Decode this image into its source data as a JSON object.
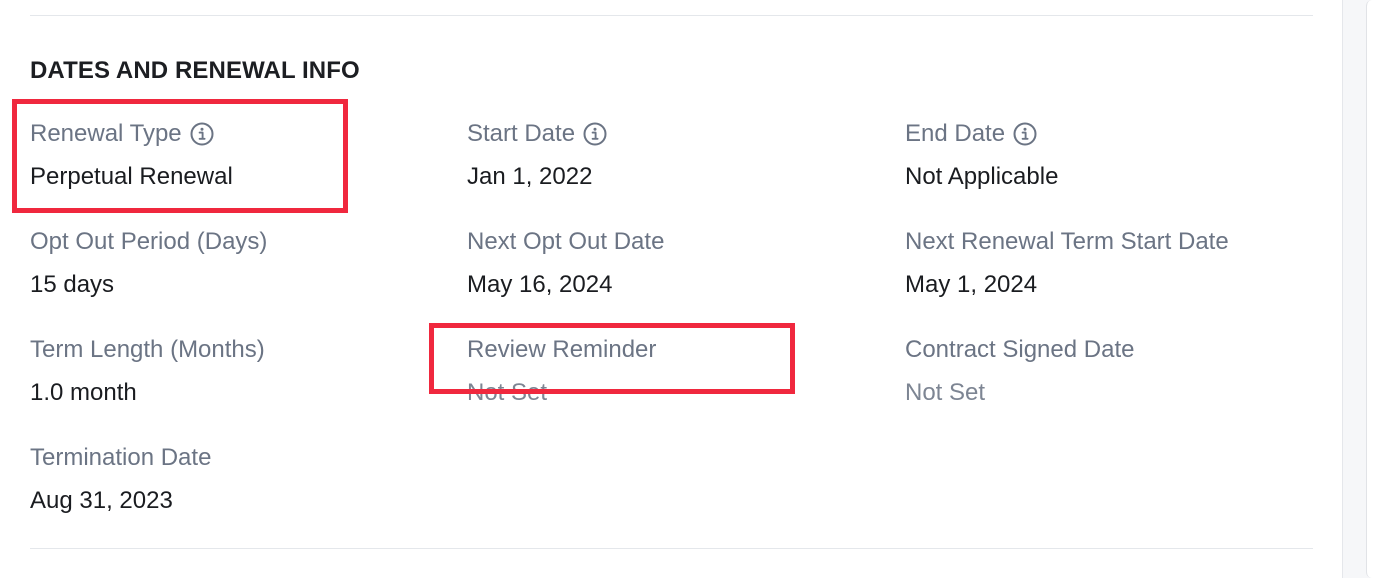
{
  "section": {
    "title": "DATES AND RENEWAL INFO"
  },
  "fields": {
    "renewal_type": {
      "label": "Renewal Type",
      "value": "Perpetual Renewal",
      "icon": "info-icon"
    },
    "start_date": {
      "label": "Start Date",
      "value": "Jan 1, 2022",
      "icon": "info-icon"
    },
    "end_date": {
      "label": "End Date",
      "value": "Not Applicable",
      "icon": "info-icon"
    },
    "opt_out_period": {
      "label": "Opt Out Period (Days)",
      "value": "15 days"
    },
    "next_opt_out_date": {
      "label": "Next Opt Out Date",
      "value": "May 16, 2024"
    },
    "next_renewal_term_start": {
      "label": "Next Renewal Term Start Date",
      "value": "May 1, 2024"
    },
    "term_length": {
      "label": "Term Length (Months)",
      "value": "1.0 month"
    },
    "review_reminder": {
      "label": "Review Reminder",
      "value": "Not Set"
    },
    "contract_signed_date": {
      "label": "Contract Signed Date",
      "value": "Not Set"
    },
    "termination_date": {
      "label": "Termination Date",
      "value": "Aug 31, 2023"
    }
  },
  "colors": {
    "highlight": "#f0283e",
    "label": "#6b7484",
    "value": "#1a1c20",
    "muted_value": "#7d8593"
  }
}
